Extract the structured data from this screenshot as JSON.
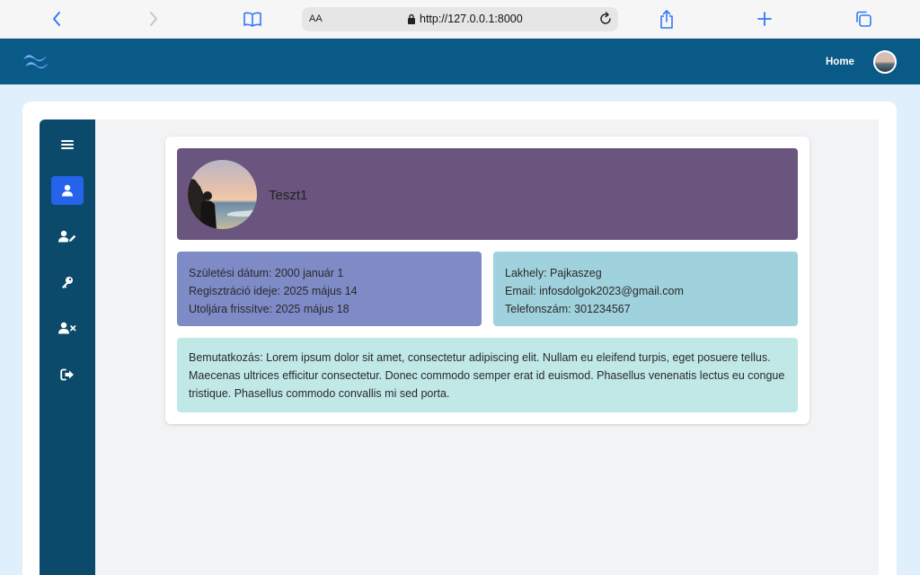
{
  "browser": {
    "text_size_label": "AA",
    "url": "http://127.0.0.1:8000"
  },
  "header": {
    "home_label": "Home"
  },
  "sidebar": {
    "items": [
      {
        "name": "menu",
        "icon": "hamburger-icon",
        "active": false
      },
      {
        "name": "profile",
        "icon": "user-icon",
        "active": true
      },
      {
        "name": "edit-profile",
        "icon": "user-edit-icon",
        "active": false
      },
      {
        "name": "change-password",
        "icon": "key-icon",
        "active": false
      },
      {
        "name": "delete-account",
        "icon": "user-remove-icon",
        "active": false
      },
      {
        "name": "logout",
        "icon": "logout-icon",
        "active": false
      }
    ]
  },
  "profile": {
    "username": "Teszt1",
    "dates": [
      "Születési dátum: 2000 január 1",
      "Regisztráció ideje: 2025 május 14",
      "Utoljára frissítve: 2025 május 18"
    ],
    "contact": [
      "Lakhely: Pajkaszeg",
      "Email: infosdolgok2023@gmail.com",
      "Telefonszám: 301234567"
    ],
    "bio": "Bemutatkozás: Lorem ipsum dolor sit amet, consectetur adipiscing elit. Nullam eu eleifend turpis, eget posuere tellus. Maecenas ultrices efficitur consectetur. Donec commodo semper erat id euismod. Phasellus venenatis lectus eu congue tristique. Phasellus commodo convallis mi sed porta."
  },
  "colors": {
    "header": "#0a5a87",
    "sidebar": "#0c4a6b",
    "active_nav": "#2563eb",
    "banner": "#6a557e",
    "dates_box": "#7e8bc6",
    "contact_box": "#9fd2dc",
    "bio_box": "#bfe8e6",
    "browser_accent": "#3478f6"
  }
}
